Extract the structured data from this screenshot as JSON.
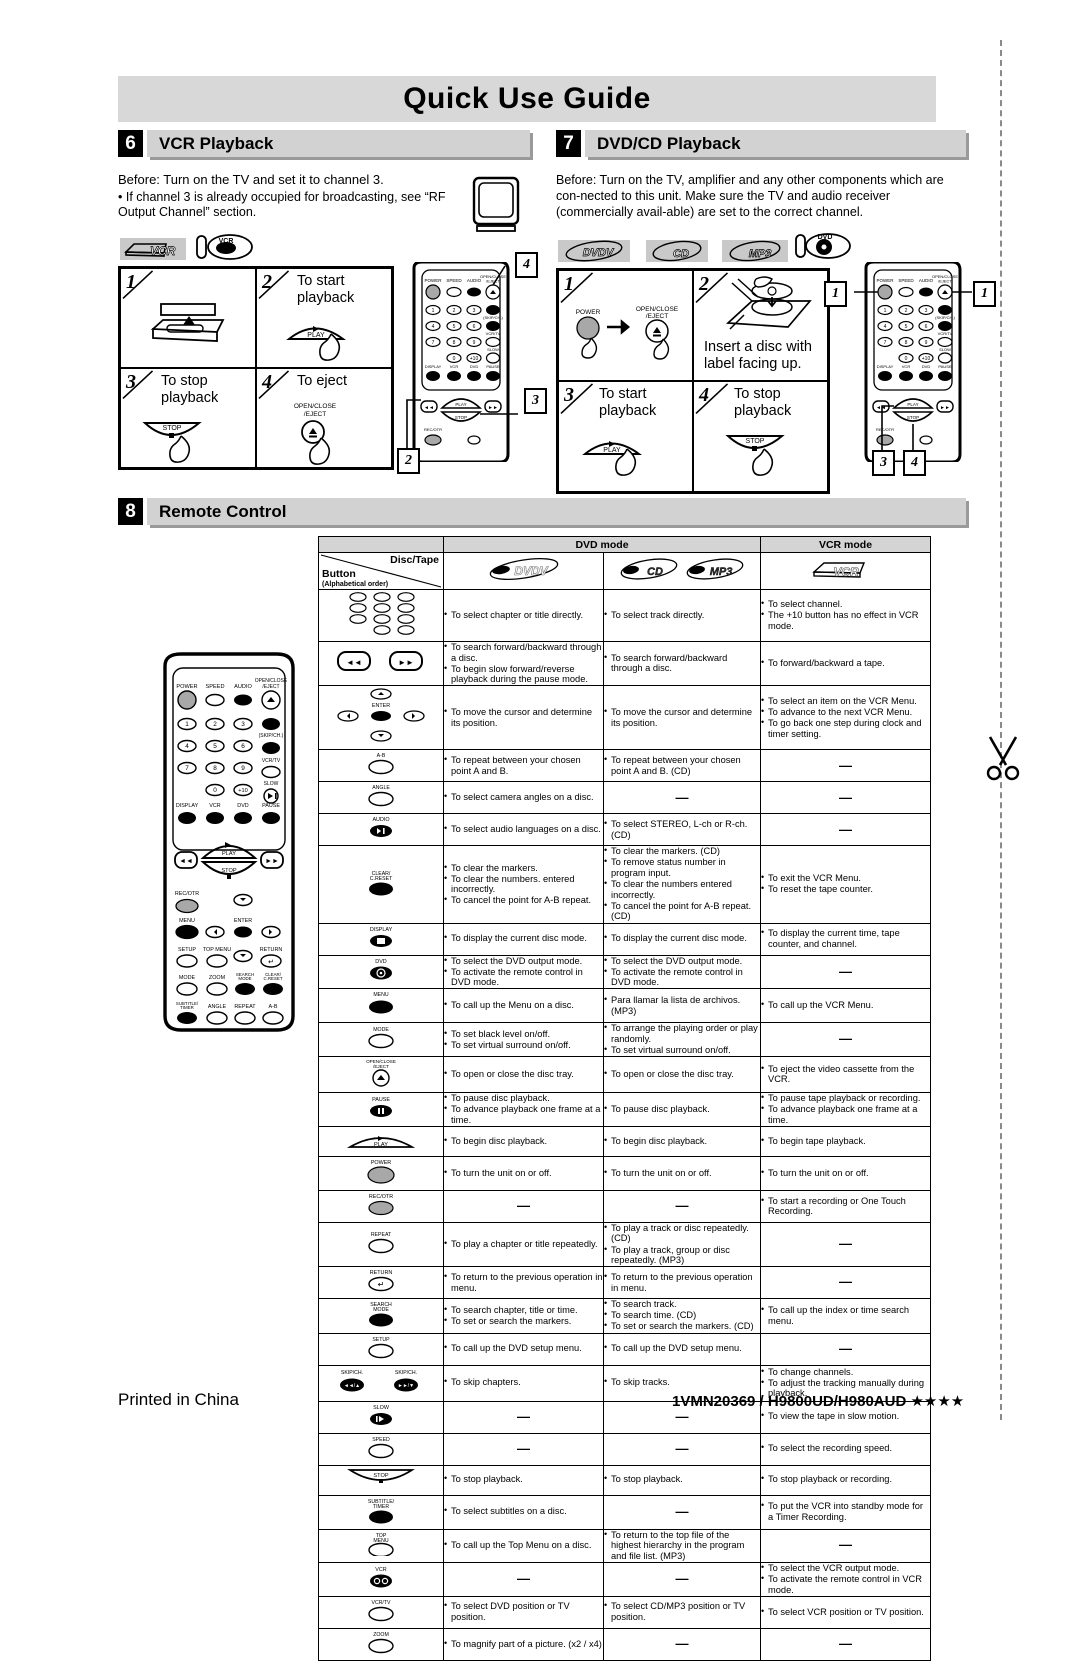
{
  "document": {
    "title": "Quick Use Guide",
    "footer_left": "Printed in China",
    "footer_right": "1VMN20369 / H9800UD/H980AUD ★★★★"
  },
  "section_vcr": {
    "number": "6",
    "title": "VCR Playback",
    "before_line": "Before:  Turn on the TV and set it to channel 3.",
    "bullet": "• If channel 3 is already occupied for broadcasting, see “RF Output Channel” section.",
    "media_tags": [
      "VCR"
    ],
    "mode_icon": "vcr-mode-icon",
    "tv_icon": "tv-icon",
    "steps": [
      {
        "num": "1",
        "text": "",
        "art": "vcr-tape-insert-art"
      },
      {
        "num": "2",
        "text": "To start playback",
        "art": "play-button-press-art"
      },
      {
        "num": "3",
        "text": "To stop playback",
        "art": "stop-button-press-art"
      },
      {
        "num": "4",
        "text": "To eject",
        "art": "eject-button-press-art",
        "art_label": "OPEN/CLOSE /EJECT"
      }
    ],
    "callouts": [
      "4",
      "2"
    ]
  },
  "section_dvd": {
    "number": "7",
    "title": "DVD/CD Playback",
    "before_line": "Before: Turn on the TV, amplifier and any other components which are con-nected to this unit. Make sure the TV and audio receiver (commercially avail-able) are set to the correct channel.",
    "media_tags": [
      "DVDV",
      "CD",
      "MP3"
    ],
    "mode_icon": "dvd-mode-icon",
    "steps": [
      {
        "num": "1",
        "text": "",
        "art": "power-then-eject-art",
        "labels": [
          "POWER",
          "OPEN/CLOSE /EJECT"
        ]
      },
      {
        "num": "2",
        "text": "Insert a disc with label facing up.",
        "art": "disc-tray-art"
      },
      {
        "num": "3",
        "text": "To start playback",
        "art": "play-button-press-art"
      },
      {
        "num": "4",
        "text": "To stop playback",
        "art": "stop-button-press-art"
      }
    ],
    "callouts": [
      "1",
      "1",
      "3",
      "4"
    ]
  },
  "section_remote": {
    "number": "8",
    "title": "Remote Control",
    "remote_illustration": "remote-control-diagram",
    "table": {
      "header_group_dvd": "DVD mode",
      "header_group_vcr": "VCR mode",
      "corner_disc_tape": "Disc/Tape",
      "corner_button": "Button",
      "corner_alpha": "(Alphabetical order)",
      "col_dvd_icon": "DVDV",
      "col_cd_icon": "CD",
      "col_mp3_icon": "MP3",
      "col_vcr_icon": "VCR",
      "dash": "—",
      "rows": [
        {
          "button": "number-buttons",
          "button_label": "",
          "dvd": [
            "To select chapter or title directly."
          ],
          "cd": [
            "To select track directly."
          ],
          "vcr": [
            "To select channel.",
            "The +10 button has no effect in VCR mode."
          ]
        },
        {
          "button": "search-fwd-rev-buttons",
          "button_label": "",
          "dvd": [
            "To search forward/backward through a disc.",
            "To begin slow forward/reverse playback during the pause mode."
          ],
          "cd": [
            "To search forward/backward through a disc."
          ],
          "vcr": [
            "To forward/backward a tape."
          ]
        },
        {
          "button": "cursor-enter-buttons",
          "button_label": "ENTER",
          "dvd": [
            "To move the cursor and determine its position."
          ],
          "cd": [
            "To move the cursor and determine its position."
          ],
          "vcr": [
            "To select an item on the VCR Menu.",
            "To advance to the next VCR Menu.",
            "To go back one step during clock and timer setting."
          ]
        },
        {
          "button": "ab-button",
          "button_label": "A-B",
          "dvd": [
            "To repeat between your chosen point A and B."
          ],
          "cd": [
            "To repeat between your chosen point A and B. (CD)"
          ],
          "vcr": "—"
        },
        {
          "button": "angle-button",
          "button_label": "ANGLE",
          "dvd": [
            "To select camera angles on a disc."
          ],
          "cd": "—",
          "vcr": "—"
        },
        {
          "button": "audio-button",
          "button_label": "AUDIO",
          "dvd": [
            "To select audio languages on a disc."
          ],
          "cd": [
            "To select STEREO, L-ch or R-ch. (CD)"
          ],
          "vcr": "—"
        },
        {
          "button": "clear-creset-button",
          "button_label": "CLEAR/ C.RESET",
          "dvd": [
            "To clear the markers.",
            "To clear the numbers. entered incorrectly.",
            "To cancel the point for A-B repeat."
          ],
          "cd": [
            "To clear the markers. (CD)",
            "To remove status number in program input.",
            "To clear the numbers entered incorrectly.",
            "To cancel the point for A-B repeat. (CD)"
          ],
          "vcr": [
            "To exit the VCR Menu.",
            "To reset the tape counter."
          ]
        },
        {
          "button": "display-button",
          "button_label": "DISPLAY",
          "dvd": [
            "To display the current disc mode."
          ],
          "cd": [
            "To display the current disc mode."
          ],
          "vcr": [
            "To display the current time, tape counter, and channel."
          ]
        },
        {
          "button": "dvd-button",
          "button_label": "DVD",
          "dvd": [
            "To select the DVD output mode.",
            "To activate the remote control in DVD mode."
          ],
          "cd": [
            "To select the DVD output mode.",
            "To activate the remote control in DVD mode."
          ],
          "vcr": "—"
        },
        {
          "button": "menu-button",
          "button_label": "MENU",
          "dvd": [
            "To call up the Menu on a disc."
          ],
          "cd": [
            "Para llamar la lista de archivos. (MP3)"
          ],
          "vcr": [
            "To call up the VCR Menu."
          ]
        },
        {
          "button": "mode-button",
          "button_label": "MODE",
          "dvd": [
            "To set black level on/off.",
            "To set virtual surround on/off."
          ],
          "cd": [
            "To arrange the playing order or play randomly.",
            "To set virtual surround on/off."
          ],
          "vcr": "—"
        },
        {
          "button": "open-close-eject-button",
          "button_label": "OPEN/CLOSE /EJECT",
          "dvd": [
            "To open or close the disc tray."
          ],
          "cd": [
            "To open or close the disc tray."
          ],
          "vcr": [
            "To eject the video cassette from the VCR."
          ]
        },
        {
          "button": "pause-button",
          "button_label": "PAUSE",
          "dvd": [
            "To pause disc playback.",
            "To advance playback one frame at a time."
          ],
          "cd": [
            "To pause disc playback."
          ],
          "vcr": [
            "To pause tape playback or recording.",
            "To advance playback one frame at a time."
          ]
        },
        {
          "button": "play-button",
          "button_label": "PLAY",
          "dvd": [
            "To begin disc playback."
          ],
          "cd": [
            "To begin disc playback."
          ],
          "vcr": [
            "To begin tape playback."
          ]
        },
        {
          "button": "power-button",
          "button_label": "POWER",
          "dvd": [
            "To turn the unit on or off."
          ],
          "cd": [
            "To turn the unit on or off."
          ],
          "vcr": [
            "To turn the unit on or off."
          ]
        },
        {
          "button": "rec-otr-button",
          "button_label": "REC/OTR",
          "dvd": "—",
          "cd": "—",
          "vcr": [
            "To start a recording or One Touch Recording."
          ]
        },
        {
          "button": "repeat-button",
          "button_label": "REPEAT",
          "dvd": [
            "To play a chapter or title repeatedly."
          ],
          "cd": [
            "To play a track or disc repeatedly. (CD)",
            "To play a track, group or disc repeatedly. (MP3)"
          ],
          "vcr": "—"
        },
        {
          "button": "return-button",
          "button_label": "RETURN",
          "dvd": [
            "To return to the previous operation in menu."
          ],
          "cd": [
            "To return to the previous operation in menu."
          ],
          "vcr": "—"
        },
        {
          "button": "search-mode-button",
          "button_label": "SEARCH MODE",
          "dvd": [
            "To search chapter, title or time.",
            "To set or search the markers."
          ],
          "cd": [
            "To search track.",
            "To search time. (CD)",
            "To set or search the markers. (CD)"
          ],
          "vcr": [
            "To call up the index or time search menu."
          ]
        },
        {
          "button": "setup-button",
          "button_label": "SETUP",
          "dvd": [
            "To call up the DVD setup menu."
          ],
          "cd": [
            "To call up the DVD setup menu."
          ],
          "vcr": "—"
        },
        {
          "button": "skip-ch-buttons",
          "button_label": "SKIP/CH.",
          "dvd": [
            "To skip chapters."
          ],
          "cd": [
            "To skip tracks."
          ],
          "vcr": [
            "To change channels.",
            "To adjust the tracking manually during playback."
          ]
        },
        {
          "button": "slow-button",
          "button_label": "SLOW",
          "dvd": "—",
          "cd": "—",
          "vcr": [
            "To view the tape in slow motion."
          ]
        },
        {
          "button": "speed-button",
          "button_label": "SPEED",
          "dvd": "—",
          "cd": "—",
          "vcr": [
            "To select the recording speed."
          ]
        },
        {
          "button": "stop-button",
          "button_label": "STOP",
          "dvd": [
            "To stop playback."
          ],
          "cd": [
            "To stop playback."
          ],
          "vcr": [
            "To stop playback or recording."
          ]
        },
        {
          "button": "subtitle-timer-button",
          "button_label": "SUBTITLE/ TIMER",
          "dvd": [
            "To select subtitles on a disc."
          ],
          "cd": "—",
          "vcr": [
            "To put the VCR into standby mode for a Timer Recording."
          ]
        },
        {
          "button": "top-menu-button",
          "button_label": "TOP MENU",
          "dvd": [
            "To call up the Top Menu on a disc."
          ],
          "cd": [
            "To return to the top file of the highest hierarchy in the program and file list. (MP3)"
          ],
          "vcr": "—"
        },
        {
          "button": "vcr-button",
          "button_label": "VCR",
          "dvd": "—",
          "cd": "—",
          "vcr": [
            "To select the VCR output mode.",
            "To activate the remote control in VCR mode."
          ]
        },
        {
          "button": "vcr-tv-button",
          "button_label": "VCR/TV",
          "dvd": [
            "To select DVD position or TV position."
          ],
          "cd": [
            "To select CD/MP3 position or TV position."
          ],
          "vcr": [
            "To select VCR position or TV position."
          ]
        },
        {
          "button": "zoom-button",
          "button_label": "ZOOM",
          "dvd": [
            "To magnify part of a picture. (x2 / x4)"
          ],
          "cd": "—",
          "vcr": "—"
        }
      ]
    }
  },
  "remote_keys": {
    "power": "POWER",
    "speed": "SPEED",
    "audio": "AUDIO",
    "open_close_eject": "OPEN/CLOSE /EJECT",
    "skip_ch": "(SKIP/CH.)",
    "vcr_tv": "VCR/TV",
    "slow": "SLOW",
    "display": "DISPLAY",
    "vcr": "VCR",
    "dvd": "DVD",
    "pause": "PAUSE",
    "play": "PLAY",
    "stop": "STOP",
    "rec_otr": "REC/OTR",
    "menu": "MENU",
    "enter": "ENTER",
    "setup": "SETUP",
    "top_menu": "TOP MENU",
    "return": "RETURN",
    "mode": "MODE",
    "zoom": "ZOOM",
    "search_mode": "SEARCH MODE",
    "clear_creset": "CLEAR/ C.RESET",
    "subtitle_timer": "SUBTITLE/ TIMER",
    "angle": "ANGLE",
    "repeat": "REPEAT",
    "ab": "A-B",
    "digits": [
      "1",
      "2",
      "3",
      "4",
      "5",
      "6",
      "7",
      "8",
      "9",
      "0",
      "+10"
    ]
  }
}
